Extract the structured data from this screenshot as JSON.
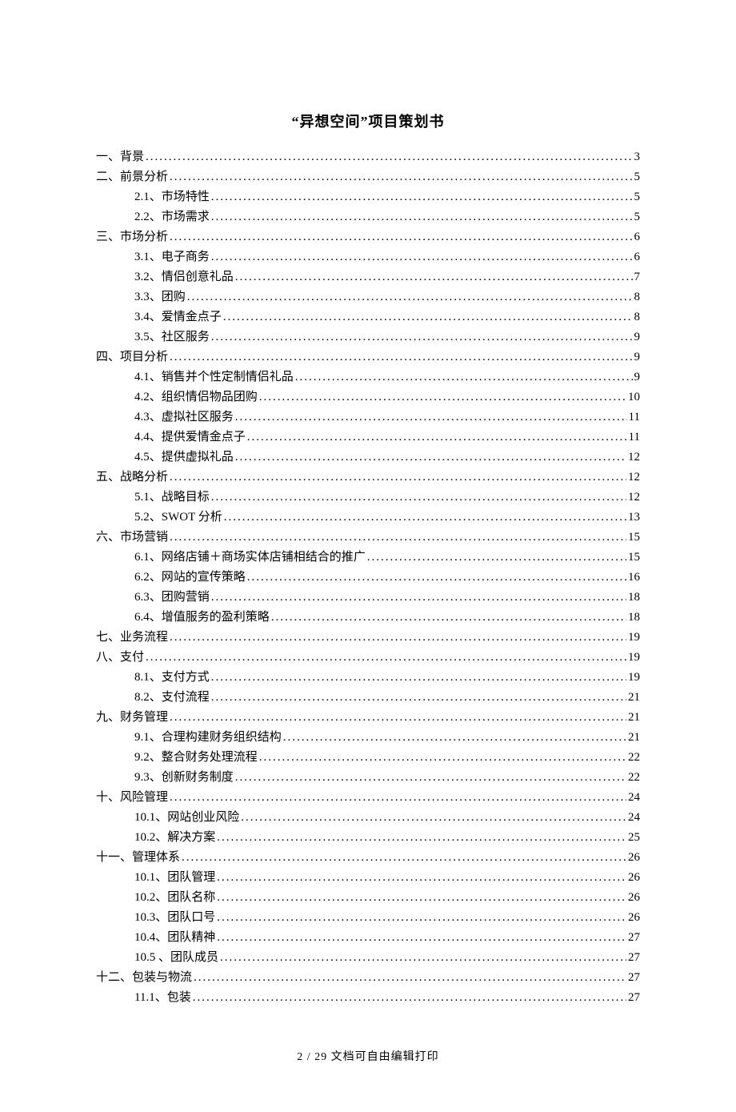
{
  "title": "“异想空间”项目策划书",
  "footer": "2 / 29 文档可自由编辑打印",
  "toc": [
    {
      "level": 1,
      "label": "一、背景",
      "page": "3"
    },
    {
      "level": 1,
      "label": "二、前景分析",
      "page": "5"
    },
    {
      "level": 2,
      "label": "2.1、市场特性",
      "page": "5"
    },
    {
      "level": 2,
      "label": "2.2、市场需求",
      "page": "5"
    },
    {
      "level": 1,
      "label": "三、市场分析",
      "page": "6"
    },
    {
      "level": 2,
      "label": "3.1、电子商务",
      "page": "6"
    },
    {
      "level": 2,
      "label": "3.2、情侣创意礼品",
      "page": "7"
    },
    {
      "level": 2,
      "label": "3.3、团购",
      "page": "8"
    },
    {
      "level": 2,
      "label": "3.4、爱情金点子",
      "page": "8"
    },
    {
      "level": 2,
      "label": "3.5、社区服务",
      "page": "9"
    },
    {
      "level": 1,
      "label": "四、项目分析",
      "page": "9"
    },
    {
      "level": 2,
      "label": "4.1、销售并个性定制情侣礼品",
      "page": "9"
    },
    {
      "level": 2,
      "label": "4.2、组织情侣物品团购",
      "page": "10"
    },
    {
      "level": 2,
      "label": "4.3、虚拟社区服务",
      "page": "11"
    },
    {
      "level": 2,
      "label": "4.4、提供爱情金点子",
      "page": "11"
    },
    {
      "level": 2,
      "label": "4.5、提供虚拟礼品",
      "page": "12"
    },
    {
      "level": 1,
      "label": "五、战略分析",
      "page": "12"
    },
    {
      "level": 2,
      "label": "5.1、战略目标",
      "page": "12"
    },
    {
      "level": 2,
      "label": "5.2、SWOT 分析",
      "page": "13"
    },
    {
      "level": 1,
      "label": "六、市场营销",
      "page": "15"
    },
    {
      "level": 2,
      "label": "6.1、网络店铺＋商场实体店铺相结合的推广",
      "page": "15"
    },
    {
      "level": 2,
      "label": "6.2、网站的宣传策略",
      "page": "16"
    },
    {
      "level": 2,
      "label": "6.3、团购营销",
      "page": "18"
    },
    {
      "level": 2,
      "label": "6.4、增值服务的盈利策略",
      "page": "18"
    },
    {
      "level": 1,
      "label": "七、业务流程",
      "page": "19"
    },
    {
      "level": 1,
      "label": "八、支付",
      "page": "19"
    },
    {
      "level": 2,
      "label": "8.1、支付方式",
      "page": "19"
    },
    {
      "level": 2,
      "label": "8.2、支付流程",
      "page": "21"
    },
    {
      "level": 1,
      "label": "九、财务管理",
      "page": "21"
    },
    {
      "level": 2,
      "label": "9.1、合理构建财务组织结构",
      "page": "21"
    },
    {
      "level": 2,
      "label": "9.2、整合财务处理流程",
      "page": "22"
    },
    {
      "level": 2,
      "label": "9.3、创新财务制度",
      "page": "22"
    },
    {
      "level": 1,
      "label": "十、风险管理",
      "page": "24"
    },
    {
      "level": 2,
      "label": "10.1、网站创业风险",
      "page": "24"
    },
    {
      "level": 2,
      "label": "10.2、解决方案",
      "page": "25"
    },
    {
      "level": 1,
      "label": "十一、管理体系",
      "page": "26"
    },
    {
      "level": 2,
      "label": "10.1、团队管理",
      "page": "26"
    },
    {
      "level": 2,
      "label": "10.2、团队名称",
      "page": "26"
    },
    {
      "level": 2,
      "label": "10.3、团队口号",
      "page": "26"
    },
    {
      "level": 2,
      "label": "10.4、团队精神",
      "page": "27"
    },
    {
      "level": 2,
      "label": "10.5 、团队成员",
      "page": "27"
    },
    {
      "level": 1,
      "label": "十二、包装与物流",
      "page": "27"
    },
    {
      "level": 2,
      "label": "11.1、包装",
      "page": "27"
    }
  ]
}
